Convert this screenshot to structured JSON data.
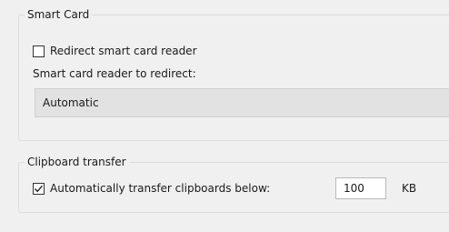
{
  "smart_card": {
    "title": "Smart Card",
    "redirect_label": "Redirect smart card reader",
    "redirect_checked": false,
    "reader_label": "Smart card reader to redirect:",
    "reader_value": "Automatic"
  },
  "clipboard": {
    "title": "Clipboard transfer",
    "auto_label": "Automatically transfer clipboards below:",
    "auto_checked": true,
    "size_value": "100",
    "unit": "KB"
  }
}
